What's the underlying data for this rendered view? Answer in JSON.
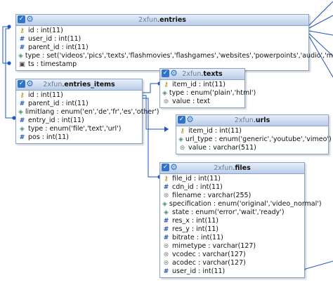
{
  "tables": [
    {
      "id": "entries",
      "db": "2xfun",
      "name": "entries",
      "columns": [
        {
          "icon": "key",
          "text": "id : int(11)"
        },
        {
          "icon": "hash",
          "text": "user_id : int(11)"
        },
        {
          "icon": "hash",
          "text": "parent_id : int(11)"
        },
        {
          "icon": "enum",
          "text": "type : set('videos','pics','texts','flashmovies','flashgames','websites','powerpoints','audio','misc')"
        },
        {
          "icon": "date",
          "text": "ts : timestamp"
        }
      ]
    },
    {
      "id": "entries_items",
      "db": "2xfun",
      "name": "entries_items",
      "columns": [
        {
          "icon": "key",
          "text": "id : int(11)"
        },
        {
          "icon": "hash",
          "text": "parent_id : int(11)"
        },
        {
          "icon": "enum",
          "text": "limitlang : enum('en','de','fr','es','other')"
        },
        {
          "icon": "hash",
          "text": "entry_id : int(11)"
        },
        {
          "icon": "enum",
          "text": "type : enum('file','text','url')"
        },
        {
          "icon": "hash",
          "text": "pos : int(11)"
        }
      ]
    },
    {
      "id": "texts",
      "db": "2xfun",
      "name": "texts",
      "columns": [
        {
          "icon": "key",
          "text": "item_id : int(11)"
        },
        {
          "icon": "enum",
          "text": "type : enum('plain','html')"
        },
        {
          "icon": "text",
          "text": "value : text"
        }
      ]
    },
    {
      "id": "urls",
      "db": "2xfun",
      "name": "urls",
      "columns": [
        {
          "icon": "key",
          "text": "item_id : int(11)"
        },
        {
          "icon": "enum",
          "text": "url_type : enum('generic','youtube','vimeo')"
        },
        {
          "icon": "text",
          "text": "value : varchar(511)"
        }
      ]
    },
    {
      "id": "files",
      "db": "2xfun",
      "name": "files",
      "columns": [
        {
          "icon": "key",
          "text": "file_id : int(11)"
        },
        {
          "icon": "hash",
          "text": "cdn_id : int(11)"
        },
        {
          "icon": "text",
          "text": "filename : varchar(255)"
        },
        {
          "icon": "enum",
          "text": "specification : enum('original','video_normal')"
        },
        {
          "icon": "enum",
          "text": "state : enum('error','wait','ready')"
        },
        {
          "icon": "hash",
          "text": "res_x : int(11)"
        },
        {
          "icon": "hash",
          "text": "res_y : int(11)"
        },
        {
          "icon": "hash",
          "text": "bitrate : int(11)"
        },
        {
          "icon": "text",
          "text": "mimetype : varchar(127)"
        },
        {
          "icon": "text",
          "text": "vcodec : varchar(127)"
        },
        {
          "icon": "text",
          "text": "acodec : varchar(127)"
        },
        {
          "icon": "hash",
          "text": "user_id : int(11)"
        }
      ]
    }
  ],
  "colors": {
    "connector": "#1f55c4",
    "header": "#b9cde9",
    "border": "#8aa4c8"
  }
}
